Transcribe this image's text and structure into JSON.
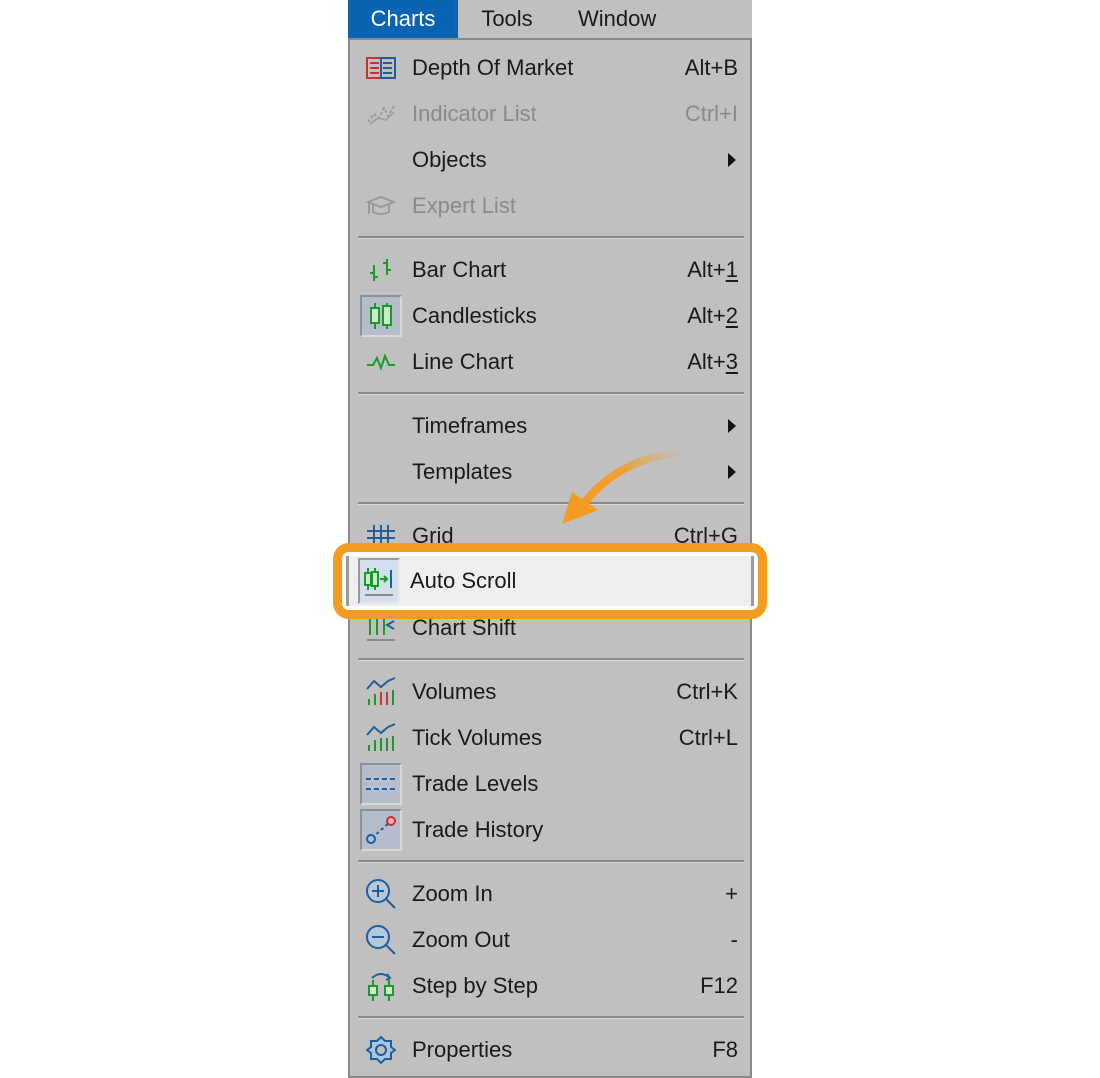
{
  "menubar": {
    "items": [
      {
        "label": "Charts",
        "active": true
      },
      {
        "label": "Tools",
        "active": false
      },
      {
        "label": "Window",
        "active": false
      }
    ]
  },
  "menu": {
    "items": [
      {
        "label": "Depth Of Market",
        "shortcut": "Alt+B",
        "icon": "depth-of-market-icon",
        "enabled": true
      },
      {
        "label": "Indicator List",
        "shortcut": "Ctrl+I",
        "icon": "indicator-list-icon",
        "enabled": false
      },
      {
        "label": "Objects",
        "submenu": true,
        "enabled": true
      },
      {
        "label": "Expert List",
        "icon": "expert-list-icon",
        "enabled": false
      },
      {
        "label": "Bar Chart",
        "shortcut_prefix": "Alt+",
        "shortcut_key": "1",
        "icon": "bar-chart-icon",
        "enabled": true
      },
      {
        "label": "Candlesticks",
        "shortcut_prefix": "Alt+",
        "shortcut_key": "2",
        "icon": "candlesticks-icon",
        "checked": true,
        "enabled": true
      },
      {
        "label": "Line Chart",
        "shortcut_prefix": "Alt+",
        "shortcut_key": "3",
        "icon": "line-chart-icon",
        "enabled": true
      },
      {
        "label": "Timeframes",
        "submenu": true,
        "enabled": true
      },
      {
        "label": "Templates",
        "submenu": true,
        "enabled": true
      },
      {
        "label": "Grid",
        "shortcut": "Ctrl+G",
        "icon": "grid-icon",
        "enabled": true
      },
      {
        "label": "Auto Scroll",
        "icon": "auto-scroll-icon",
        "checked": true,
        "highlighted": true,
        "enabled": true
      },
      {
        "label": "Chart Shift",
        "icon": "chart-shift-icon",
        "enabled": true
      },
      {
        "label": "Volumes",
        "shortcut": "Ctrl+K",
        "icon": "volumes-icon",
        "enabled": true
      },
      {
        "label": "Tick Volumes",
        "shortcut": "Ctrl+L",
        "icon": "tick-volumes-icon",
        "enabled": true
      },
      {
        "label": "Trade Levels",
        "icon": "trade-levels-icon",
        "checked": true,
        "enabled": true
      },
      {
        "label": "Trade History",
        "icon": "trade-history-icon",
        "checked": true,
        "enabled": true
      },
      {
        "label": "Zoom In",
        "shortcut": "+",
        "icon": "zoom-in-icon",
        "enabled": true
      },
      {
        "label": "Zoom Out",
        "shortcut": "-",
        "icon": "zoom-out-icon",
        "enabled": true
      },
      {
        "label": "Step by Step",
        "shortcut": "F12",
        "icon": "step-by-step-icon",
        "enabled": true
      },
      {
        "label": "Properties",
        "shortcut": "F8",
        "icon": "properties-icon",
        "enabled": true
      }
    ]
  },
  "annotation": {
    "color": "#f39c20",
    "target": "Auto Scroll"
  },
  "colors": {
    "menu_bg": "#c0c0c0",
    "active_menu_bg": "#0a64b4",
    "icon_green": "#1a9a2a",
    "icon_blue": "#1f5f9a",
    "icon_red": "#c83232"
  }
}
